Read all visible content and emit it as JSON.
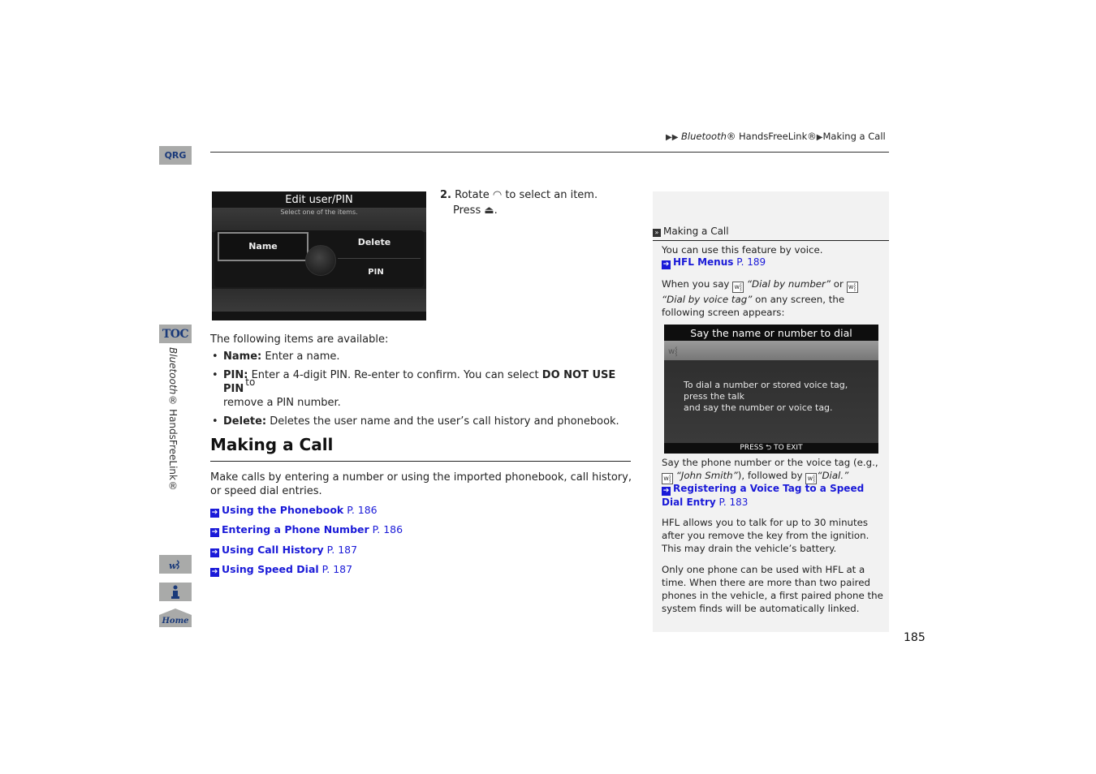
{
  "breadcrumb": {
    "arrows": "▶▶",
    "part1_italic": "Bluetooth",
    "part1_rest": "® HandsFreeLink®",
    "sep": "▶",
    "part2": "Making a Call"
  },
  "side_nav": {
    "qrg_label": "QRG",
    "toc_label": "TOC",
    "section_italic": "Bluetooth",
    "section_rest": "® HandsFreeLink®",
    "voice_icon": "voice-command-icon",
    "info_icon": "info-icon",
    "home_label": "Home"
  },
  "screen1": {
    "title": "Edit user/PIN",
    "subtitle": "Select one of the items.",
    "items": [
      "Name",
      "Delete",
      "PIN"
    ],
    "selected": "Name"
  },
  "step": {
    "number": "2.",
    "text1a": "Rotate",
    "text1b": "to select an item.",
    "text2a": "Press",
    "text2b": ".",
    "rotate_icon": "◠",
    "press_icon": "⏏"
  },
  "items_section": {
    "intro": "The following items are available:",
    "items": [
      {
        "label": "Name:",
        "text": "Enter a name."
      },
      {
        "label": "PIN:",
        "text": "Enter a 4-digit PIN. Re-enter to confirm. You can select",
        "bold_option": "DO NOT USE PIN",
        "sup": "to",
        "text_after": "remove a PIN number."
      },
      {
        "label": "Delete:",
        "text": "Deletes the user name and the user’s call history and phonebook."
      }
    ]
  },
  "making_a_call": {
    "heading": "Making a Call",
    "intro": "Make calls by entering a number or using the imported phonebook, call history, or speed dial entries.",
    "links": [
      {
        "label": "Using the Phonebook",
        "page": "P. 186"
      },
      {
        "label": "Entering a Phone Number",
        "page": "P. 186"
      },
      {
        "label": "Using Call History",
        "page": "P. 187"
      },
      {
        "label": "Using Speed Dial",
        "page": "P. 187"
      }
    ]
  },
  "sidebar_panel": {
    "heading": "Making a Call",
    "p1": "You can use this feature by voice.",
    "p1_link": {
      "label": "HFL Menus",
      "page": "P. 189"
    },
    "p2_a": "When you say",
    "p2_cmd1": "“Dial by number”",
    "p2_or": "or",
    "p2_cmd2": "“Dial by voice tag”",
    "p2_b": "on any screen, the following screen appears:",
    "screen2": {
      "title": "Say the name or number to dial",
      "message": "To dial a number or stored voice tag,\npress the talk\nand say the number or voice tag.",
      "footer": "PRESS ⮌ TO EXIT"
    },
    "p3_a": "Say the phone number or the voice tag (e.g.,",
    "p3_name": "“John Smith”",
    "p3_b": "), followed by",
    "p3_dial": "“Dial.”",
    "p3_link": {
      "label": "Registering a Voice Tag to a Speed Dial Entry",
      "page": "P. 183"
    },
    "p4": "HFL allows you to talk for up to 30 minutes after you remove the key from the ignition. This may drain the vehicle’s battery.",
    "p5": "Only one phone can be used with HFL at a time. When there are more than two paired phones in the vehicle, a first paired phone the system finds will be automatically linked."
  },
  "page_number": "185"
}
